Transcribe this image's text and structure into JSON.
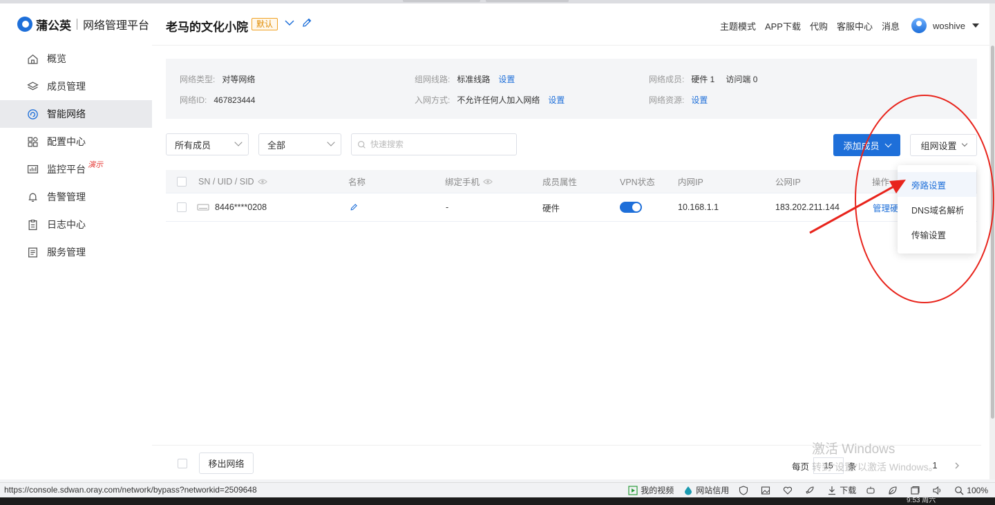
{
  "brand": {
    "name": "蒲公英",
    "subtitle": "网络管理平台"
  },
  "sidebar": {
    "items": [
      {
        "label": "概览",
        "icon": "home-icon"
      },
      {
        "label": "成员管理",
        "icon": "layers-icon"
      },
      {
        "label": "智能网络",
        "icon": "network-icon",
        "active": true
      },
      {
        "label": "配置中心",
        "icon": "grid-icon"
      },
      {
        "label": "监控平台",
        "icon": "monitor-icon",
        "badge": "演示"
      },
      {
        "label": "告警管理",
        "icon": "bell-icon"
      },
      {
        "label": "日志中心",
        "icon": "clipboard-icon"
      },
      {
        "label": "服务管理",
        "icon": "document-icon"
      }
    ]
  },
  "header": {
    "title": "老马的文化小院",
    "badge": "默认",
    "links": [
      "主题模式",
      "APP下载",
      "代购",
      "客服中心",
      "消息"
    ],
    "username": "woshive"
  },
  "info": {
    "network_type": {
      "label": "网络类型:",
      "value": "对等网络"
    },
    "network_id": {
      "label": "网络ID:",
      "value": "467823444"
    },
    "route": {
      "label": "组网线路:",
      "value": "标准线路",
      "link": "设置"
    },
    "join_mode": {
      "label": "入网方式:",
      "value": "不允许任何人加入网络",
      "link": "设置"
    },
    "members": {
      "label": "网络成员:",
      "hardware": "硬件 1",
      "visitors": "访问端 0"
    },
    "resources": {
      "label": "网络资源:",
      "link": "设置"
    }
  },
  "filters": {
    "member_filter": "所有成员",
    "type_filter": "全部",
    "search_placeholder": "快速搜索"
  },
  "actions": {
    "add_member": "添加成员",
    "network_settings": "组网设置"
  },
  "table": {
    "columns": [
      "SN / UID / SID",
      "名称",
      "绑定手机",
      "成员属性",
      "VPN状态",
      "内网IP",
      "公网IP",
      "操作"
    ],
    "rows": [
      {
        "sn": "8446****0208",
        "name": "",
        "phone": "-",
        "attribute": "硬件",
        "vpn_on": true,
        "lan_ip": "10.168.1.1",
        "wan_ip": "183.202.211.144",
        "action": "管理硬"
      }
    ]
  },
  "dropdown": {
    "items": [
      "旁路设置",
      "DNS域名解析",
      "传输设置"
    ],
    "hovered": "旁路设置"
  },
  "footer": {
    "remove_button": "移出网络",
    "per_page_label": "每页",
    "per_page_value": "15",
    "per_page_suffix": "条",
    "page": "1"
  },
  "watermark": {
    "line1": "激活 Windows",
    "line2": "转到\"设置\"以激活 Windows。"
  },
  "status_bar": {
    "url": "https://console.sdwan.oray.com/network/bypass?networkid=2509648",
    "items": [
      {
        "label": "我的视频",
        "icon": "play-icon"
      },
      {
        "label": "网站信用",
        "icon": "drop-icon"
      },
      {
        "label": "",
        "icon": "shield-icon"
      },
      {
        "label": "",
        "icon": "image-icon"
      },
      {
        "label": "",
        "icon": "heart-pulse-icon"
      },
      {
        "label": "",
        "icon": "rocket-icon"
      },
      {
        "label": "下载",
        "icon": "download-icon"
      },
      {
        "label": "",
        "icon": "robot-icon"
      },
      {
        "label": "",
        "icon": "leaf-icon"
      },
      {
        "label": "",
        "icon": "window-icon"
      },
      {
        "label": "",
        "icon": "speaker-icon"
      },
      {
        "label": "100%",
        "icon": "zoom-icon"
      }
    ]
  },
  "taskbar": {
    "time": "9:53 周六"
  },
  "colors": {
    "accent": "#1e6fd9",
    "annotation": "#e8241c",
    "badge": "#e08a00"
  }
}
